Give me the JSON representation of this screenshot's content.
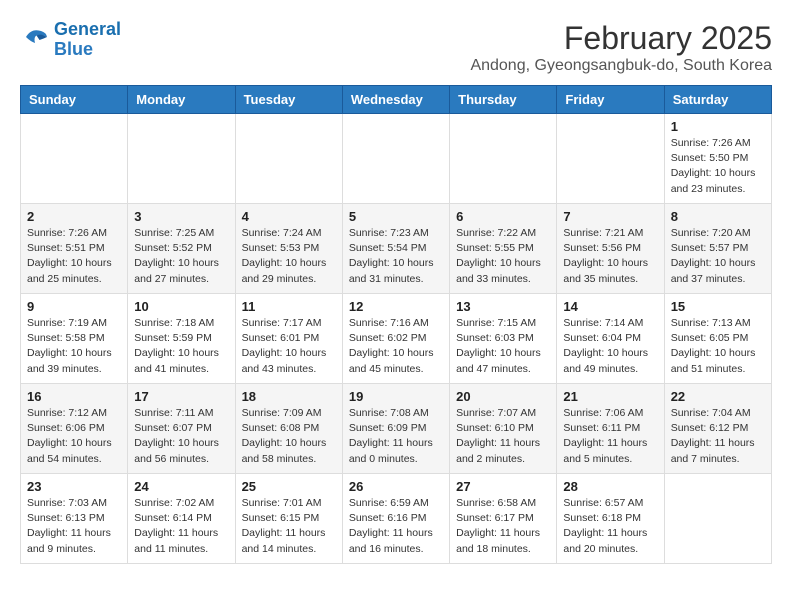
{
  "header": {
    "logo_line1": "General",
    "logo_line2": "Blue",
    "title": "February 2025",
    "subtitle": "Andong, Gyeongsangbuk-do, South Korea"
  },
  "days_of_week": [
    "Sunday",
    "Monday",
    "Tuesday",
    "Wednesday",
    "Thursday",
    "Friday",
    "Saturday"
  ],
  "weeks": [
    [
      {
        "num": "",
        "info": ""
      },
      {
        "num": "",
        "info": ""
      },
      {
        "num": "",
        "info": ""
      },
      {
        "num": "",
        "info": ""
      },
      {
        "num": "",
        "info": ""
      },
      {
        "num": "",
        "info": ""
      },
      {
        "num": "1",
        "info": "Sunrise: 7:26 AM\nSunset: 5:50 PM\nDaylight: 10 hours\nand 23 minutes."
      }
    ],
    [
      {
        "num": "2",
        "info": "Sunrise: 7:26 AM\nSunset: 5:51 PM\nDaylight: 10 hours\nand 25 minutes."
      },
      {
        "num": "3",
        "info": "Sunrise: 7:25 AM\nSunset: 5:52 PM\nDaylight: 10 hours\nand 27 minutes."
      },
      {
        "num": "4",
        "info": "Sunrise: 7:24 AM\nSunset: 5:53 PM\nDaylight: 10 hours\nand 29 minutes."
      },
      {
        "num": "5",
        "info": "Sunrise: 7:23 AM\nSunset: 5:54 PM\nDaylight: 10 hours\nand 31 minutes."
      },
      {
        "num": "6",
        "info": "Sunrise: 7:22 AM\nSunset: 5:55 PM\nDaylight: 10 hours\nand 33 minutes."
      },
      {
        "num": "7",
        "info": "Sunrise: 7:21 AM\nSunset: 5:56 PM\nDaylight: 10 hours\nand 35 minutes."
      },
      {
        "num": "8",
        "info": "Sunrise: 7:20 AM\nSunset: 5:57 PM\nDaylight: 10 hours\nand 37 minutes."
      }
    ],
    [
      {
        "num": "9",
        "info": "Sunrise: 7:19 AM\nSunset: 5:58 PM\nDaylight: 10 hours\nand 39 minutes."
      },
      {
        "num": "10",
        "info": "Sunrise: 7:18 AM\nSunset: 5:59 PM\nDaylight: 10 hours\nand 41 minutes."
      },
      {
        "num": "11",
        "info": "Sunrise: 7:17 AM\nSunset: 6:01 PM\nDaylight: 10 hours\nand 43 minutes."
      },
      {
        "num": "12",
        "info": "Sunrise: 7:16 AM\nSunset: 6:02 PM\nDaylight: 10 hours\nand 45 minutes."
      },
      {
        "num": "13",
        "info": "Sunrise: 7:15 AM\nSunset: 6:03 PM\nDaylight: 10 hours\nand 47 minutes."
      },
      {
        "num": "14",
        "info": "Sunrise: 7:14 AM\nSunset: 6:04 PM\nDaylight: 10 hours\nand 49 minutes."
      },
      {
        "num": "15",
        "info": "Sunrise: 7:13 AM\nSunset: 6:05 PM\nDaylight: 10 hours\nand 51 minutes."
      }
    ],
    [
      {
        "num": "16",
        "info": "Sunrise: 7:12 AM\nSunset: 6:06 PM\nDaylight: 10 hours\nand 54 minutes."
      },
      {
        "num": "17",
        "info": "Sunrise: 7:11 AM\nSunset: 6:07 PM\nDaylight: 10 hours\nand 56 minutes."
      },
      {
        "num": "18",
        "info": "Sunrise: 7:09 AM\nSunset: 6:08 PM\nDaylight: 10 hours\nand 58 minutes."
      },
      {
        "num": "19",
        "info": "Sunrise: 7:08 AM\nSunset: 6:09 PM\nDaylight: 11 hours\nand 0 minutes."
      },
      {
        "num": "20",
        "info": "Sunrise: 7:07 AM\nSunset: 6:10 PM\nDaylight: 11 hours\nand 2 minutes."
      },
      {
        "num": "21",
        "info": "Sunrise: 7:06 AM\nSunset: 6:11 PM\nDaylight: 11 hours\nand 5 minutes."
      },
      {
        "num": "22",
        "info": "Sunrise: 7:04 AM\nSunset: 6:12 PM\nDaylight: 11 hours\nand 7 minutes."
      }
    ],
    [
      {
        "num": "23",
        "info": "Sunrise: 7:03 AM\nSunset: 6:13 PM\nDaylight: 11 hours\nand 9 minutes."
      },
      {
        "num": "24",
        "info": "Sunrise: 7:02 AM\nSunset: 6:14 PM\nDaylight: 11 hours\nand 11 minutes."
      },
      {
        "num": "25",
        "info": "Sunrise: 7:01 AM\nSunset: 6:15 PM\nDaylight: 11 hours\nand 14 minutes."
      },
      {
        "num": "26",
        "info": "Sunrise: 6:59 AM\nSunset: 6:16 PM\nDaylight: 11 hours\nand 16 minutes."
      },
      {
        "num": "27",
        "info": "Sunrise: 6:58 AM\nSunset: 6:17 PM\nDaylight: 11 hours\nand 18 minutes."
      },
      {
        "num": "28",
        "info": "Sunrise: 6:57 AM\nSunset: 6:18 PM\nDaylight: 11 hours\nand 20 minutes."
      },
      {
        "num": "",
        "info": ""
      }
    ]
  ]
}
